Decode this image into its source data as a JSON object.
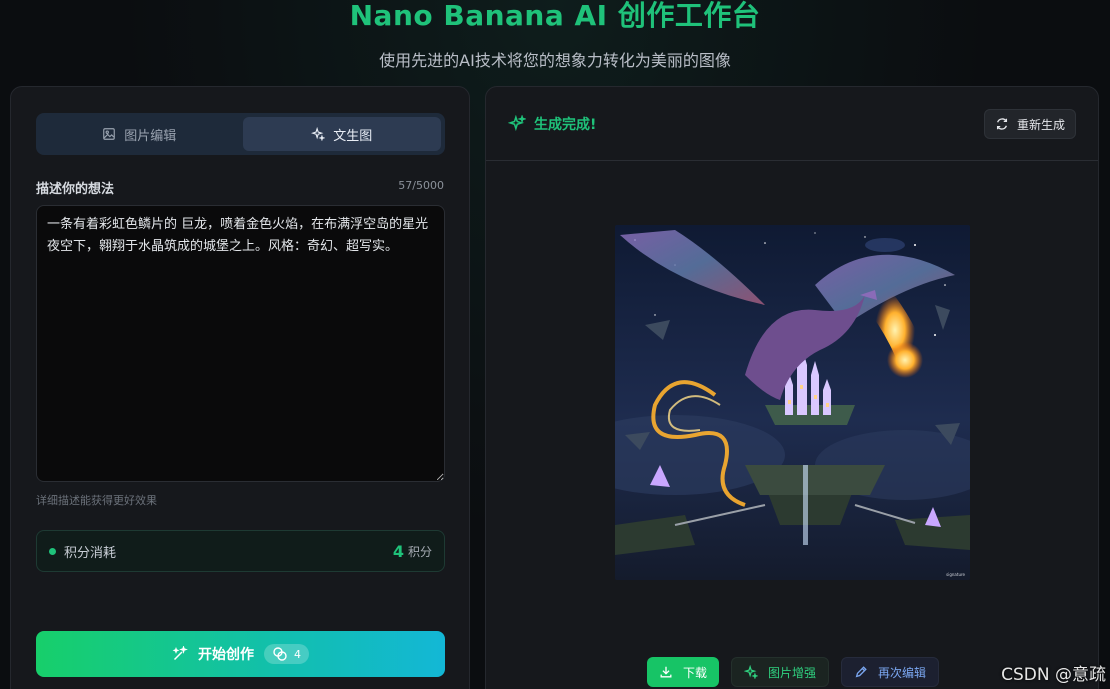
{
  "header": {
    "title": "Nano Banana AI 创作工作台",
    "subtitle": "使用先进的AI技术将您的想象力转化为美丽的图像"
  },
  "left_panel": {
    "tabs": [
      {
        "label": "图片编辑",
        "icon": "image-icon",
        "active": false
      },
      {
        "label": "文生图",
        "icon": "sparkles-icon",
        "active": true
      }
    ],
    "prompt_label": "描述你的想法",
    "char_count": "57/5000",
    "prompt_value": "一条有着彩虹色鳞片的 巨龙，喷着金色火焰，在布满浮空岛的星光夜空下，翱翔于水晶筑成的城堡之上。风格：奇幻、超写实。",
    "prompt_hint": "详细描述能获得更好效果",
    "credits": {
      "label": "积分消耗",
      "value": "4",
      "unit": "积分"
    },
    "start_button": {
      "label": "开始创作",
      "cost": "4"
    }
  },
  "right_panel": {
    "status": "生成完成!",
    "regenerate_label": "重新生成",
    "actions": {
      "download": "下载",
      "enhance": "图片增强",
      "reedit": "再次编辑"
    }
  },
  "watermark": "CSDN @意疏",
  "colors": {
    "accent": "#1fc27a",
    "panel": "#16181c",
    "background": "#0b0d10"
  }
}
